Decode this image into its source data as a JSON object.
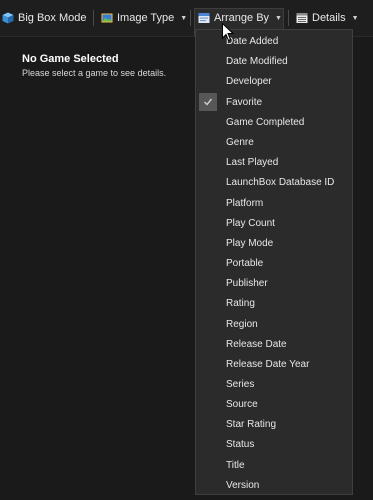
{
  "toolbar": {
    "big_box_mode": "Big Box Mode",
    "image_type": "Image Type",
    "arrange_by": "Arrange By",
    "details": "Details"
  },
  "game_panel": {
    "title": "No Game Selected",
    "subtitle": "Please select a game to see details."
  },
  "arrange_menu": {
    "checked_item": "Favorite",
    "items": [
      "Date Added",
      "Date Modified",
      "Developer",
      "Favorite",
      "Game Completed",
      "Genre",
      "Last Played",
      "LaunchBox Database ID",
      "Platform",
      "Play Count",
      "Play Mode",
      "Portable",
      "Publisher",
      "Rating",
      "Region",
      "Release Date",
      "Release Date Year",
      "Series",
      "Source",
      "Star Rating",
      "Status",
      "Title",
      "Version"
    ]
  }
}
